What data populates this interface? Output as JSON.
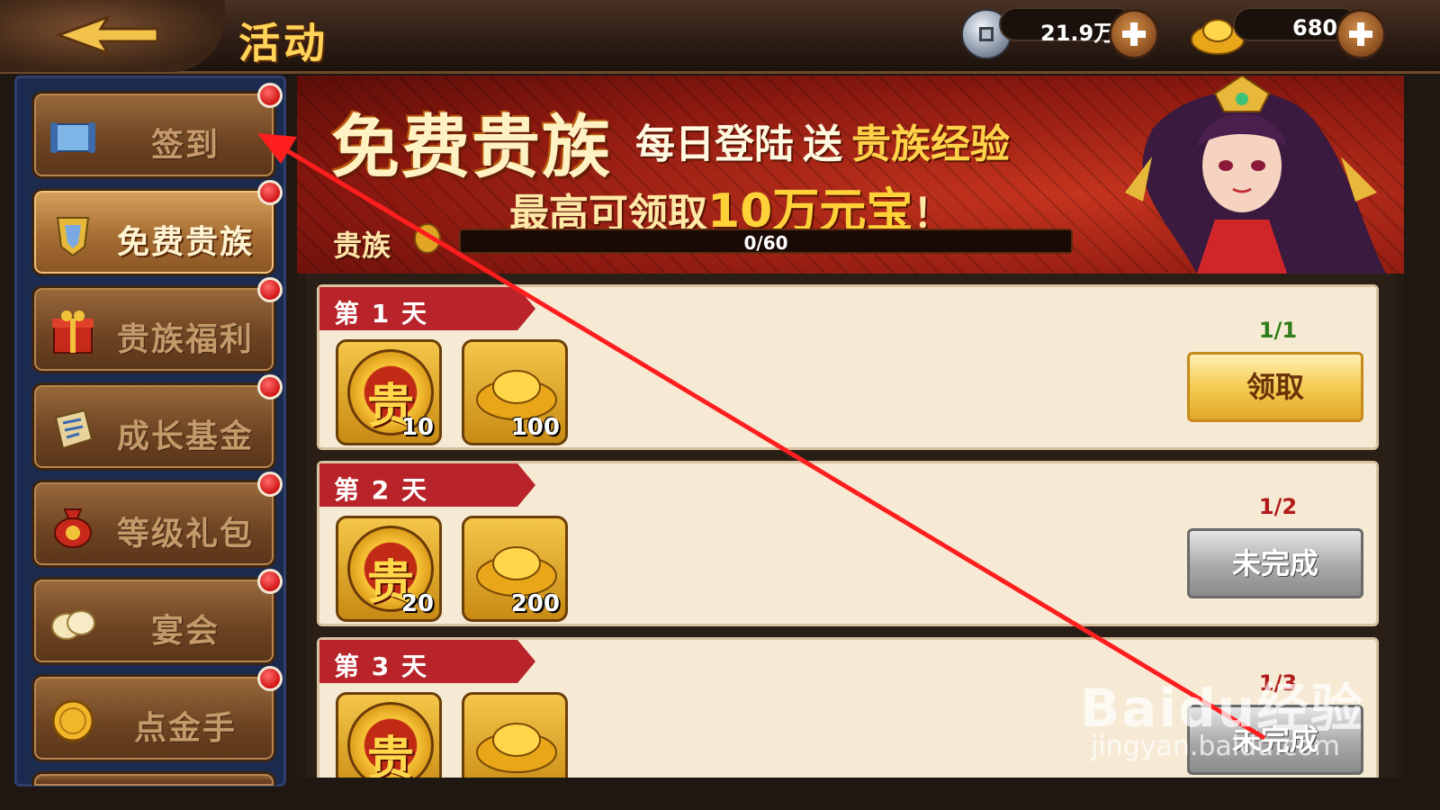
{
  "header": {
    "title": "活动",
    "silver": "21.9万",
    "gold": "680"
  },
  "sidebar": {
    "items": [
      {
        "label": "签到",
        "icon": "scroll-icon",
        "active": false,
        "has_badge": true
      },
      {
        "label": "免费贵族",
        "icon": "crest-icon",
        "active": true,
        "has_badge": true
      },
      {
        "label": "贵族福利",
        "icon": "gift-box-icon",
        "active": false,
        "has_badge": true
      },
      {
        "label": "成长基金",
        "icon": "map-scroll-icon",
        "active": false,
        "has_badge": true
      },
      {
        "label": "等级礼包",
        "icon": "money-bag-icon",
        "active": false,
        "has_badge": true
      },
      {
        "label": "宴会",
        "icon": "buns-icon",
        "active": false,
        "has_badge": true
      },
      {
        "label": "点金手",
        "icon": "gold-coin-icon",
        "active": false,
        "has_badge": true
      }
    ]
  },
  "banner": {
    "title": "免费贵族",
    "sub1_a": "每日登陆",
    "sub1_b": "送",
    "sub1_c": "贵族经验",
    "sub2_a": "最高可领取",
    "sub2_b": "10万元宝",
    "sub2_c": "！",
    "noble_label": "贵族",
    "progress_text": "0/60",
    "progress_value": 0,
    "progress_max": 60
  },
  "days": [
    {
      "label": "第 1 天",
      "rewards": [
        {
          "type": "noble-coin",
          "glyph": "贵",
          "qty": "10"
        },
        {
          "type": "gold-ingot",
          "qty": "100"
        }
      ],
      "count": "1/1",
      "count_ok": true,
      "button": "领取",
      "button_state": "claim"
    },
    {
      "label": "第 2 天",
      "rewards": [
        {
          "type": "noble-coin",
          "glyph": "贵",
          "qty": "20"
        },
        {
          "type": "gold-ingot",
          "qty": "200"
        }
      ],
      "count": "1/2",
      "count_ok": false,
      "button": "未完成",
      "button_state": "pending"
    },
    {
      "label": "第 3 天",
      "rewards": [
        {
          "type": "noble-coin",
          "glyph": "贵",
          "qty": ""
        },
        {
          "type": "gold-ingot",
          "qty": ""
        }
      ],
      "count": "1/3",
      "count_ok": false,
      "button": "未完成",
      "button_state": "pending"
    }
  ],
  "watermark": {
    "logo": "Baidu经验",
    "url": "jingyan.baidu.com"
  },
  "colors": {
    "annotation_arrow": "#ff1e1e",
    "badge_red": "#d11616",
    "claim_gold": "#f5cc52"
  }
}
